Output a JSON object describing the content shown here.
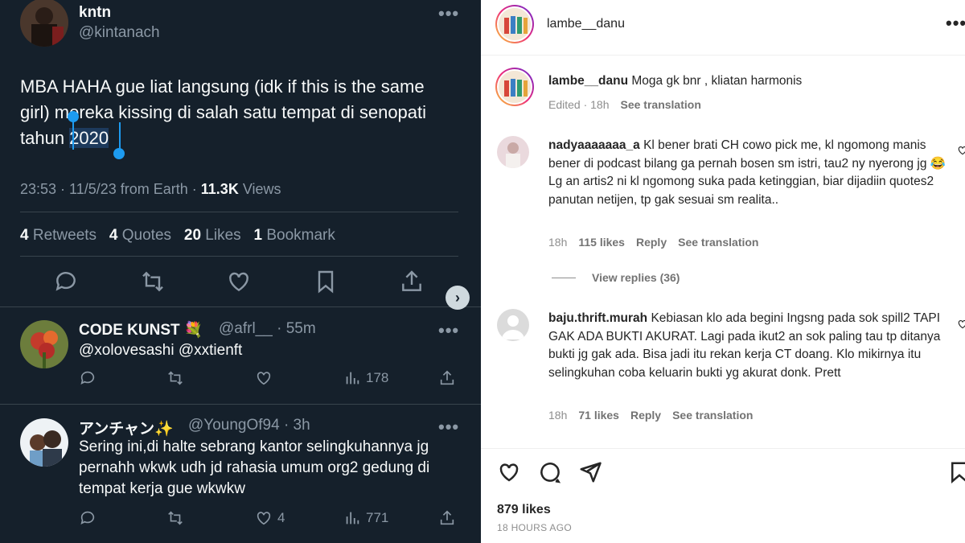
{
  "twitter": {
    "main": {
      "name": "kntn",
      "handle": "@kintanach",
      "more": "•••",
      "text_before": "MBA HAHA gue liat langsung (idk if this is the same girl) mereka kissing di salah satu tempat di senopati tahun ",
      "text_selected": "2020",
      "time": "23:53 · 11/5/23 from Earth · ",
      "views_count": "11.3K",
      "views_label": " Views",
      "stats": {
        "retweets_count": "4",
        "retweets_label": "Retweets",
        "quotes_count": "4",
        "quotes_label": "Quotes",
        "likes_count": "20",
        "likes_label": "Likes",
        "bookmarks_count": "1",
        "bookmarks_label": "Bookmark"
      }
    },
    "nav_arrow": "›",
    "replies": [
      {
        "name": "CODE KUNST 💐",
        "handle": "@afrl__ · 55m",
        "mentions": "@xolovesashi @xxtienft",
        "views": "178"
      },
      {
        "name": "アンチャン✨",
        "handle": "@YoungOf94 · 3h",
        "text": "Sering ini,di halte sebrang kantor selingkuhannya jg pernahh wkwk udh jd rahasia umum org2 gedung di tempat kerja gue wkwkw",
        "likes": "4",
        "views": "771"
      }
    ]
  },
  "instagram": {
    "header_user": "lambe__danu",
    "more": "•••",
    "caption": {
      "user": "lambe__danu",
      "text": "Moga gk bnr , kliatan harmonis",
      "edited": "Edited · 18h",
      "see_translation": "See translation"
    },
    "comments": [
      {
        "user": "nadyaaaaaaa_a",
        "text": "Kl bener brati CH cowo pick me, kl ngomong manis bener di podcast bilang ga pernah bosen sm istri, tau2 ny nyerong jg 😂 Lg an artis2 ni kl ngomong suka pada ketinggian, biar dijadiin quotes2 panutan netijen, tp gak sesuai sm realita..",
        "time": "18h",
        "likes": "115 likes",
        "reply": "Reply",
        "see_translation": "See translation",
        "view_replies": "View replies (36)"
      },
      {
        "user": "baju.thrift.murah",
        "text": "Kebiasan klo ada begini Ingsng pada sok spill2 TAPI GAK ADA BUKTI AKURAT. Lagi pada ikut2 an sok paling tau tp ditanya bukti jg gak ada. Bisa jadi itu rekan kerja CT doang. Klo mikirnya itu selingkuhan coba keluarin bukti yg akurat donk. Prett",
        "time": "18h",
        "likes": "71 likes",
        "reply": "Reply",
        "see_translation": "See translation"
      }
    ],
    "likes_total": "879 likes",
    "posted": "18 HOURS AGO"
  }
}
